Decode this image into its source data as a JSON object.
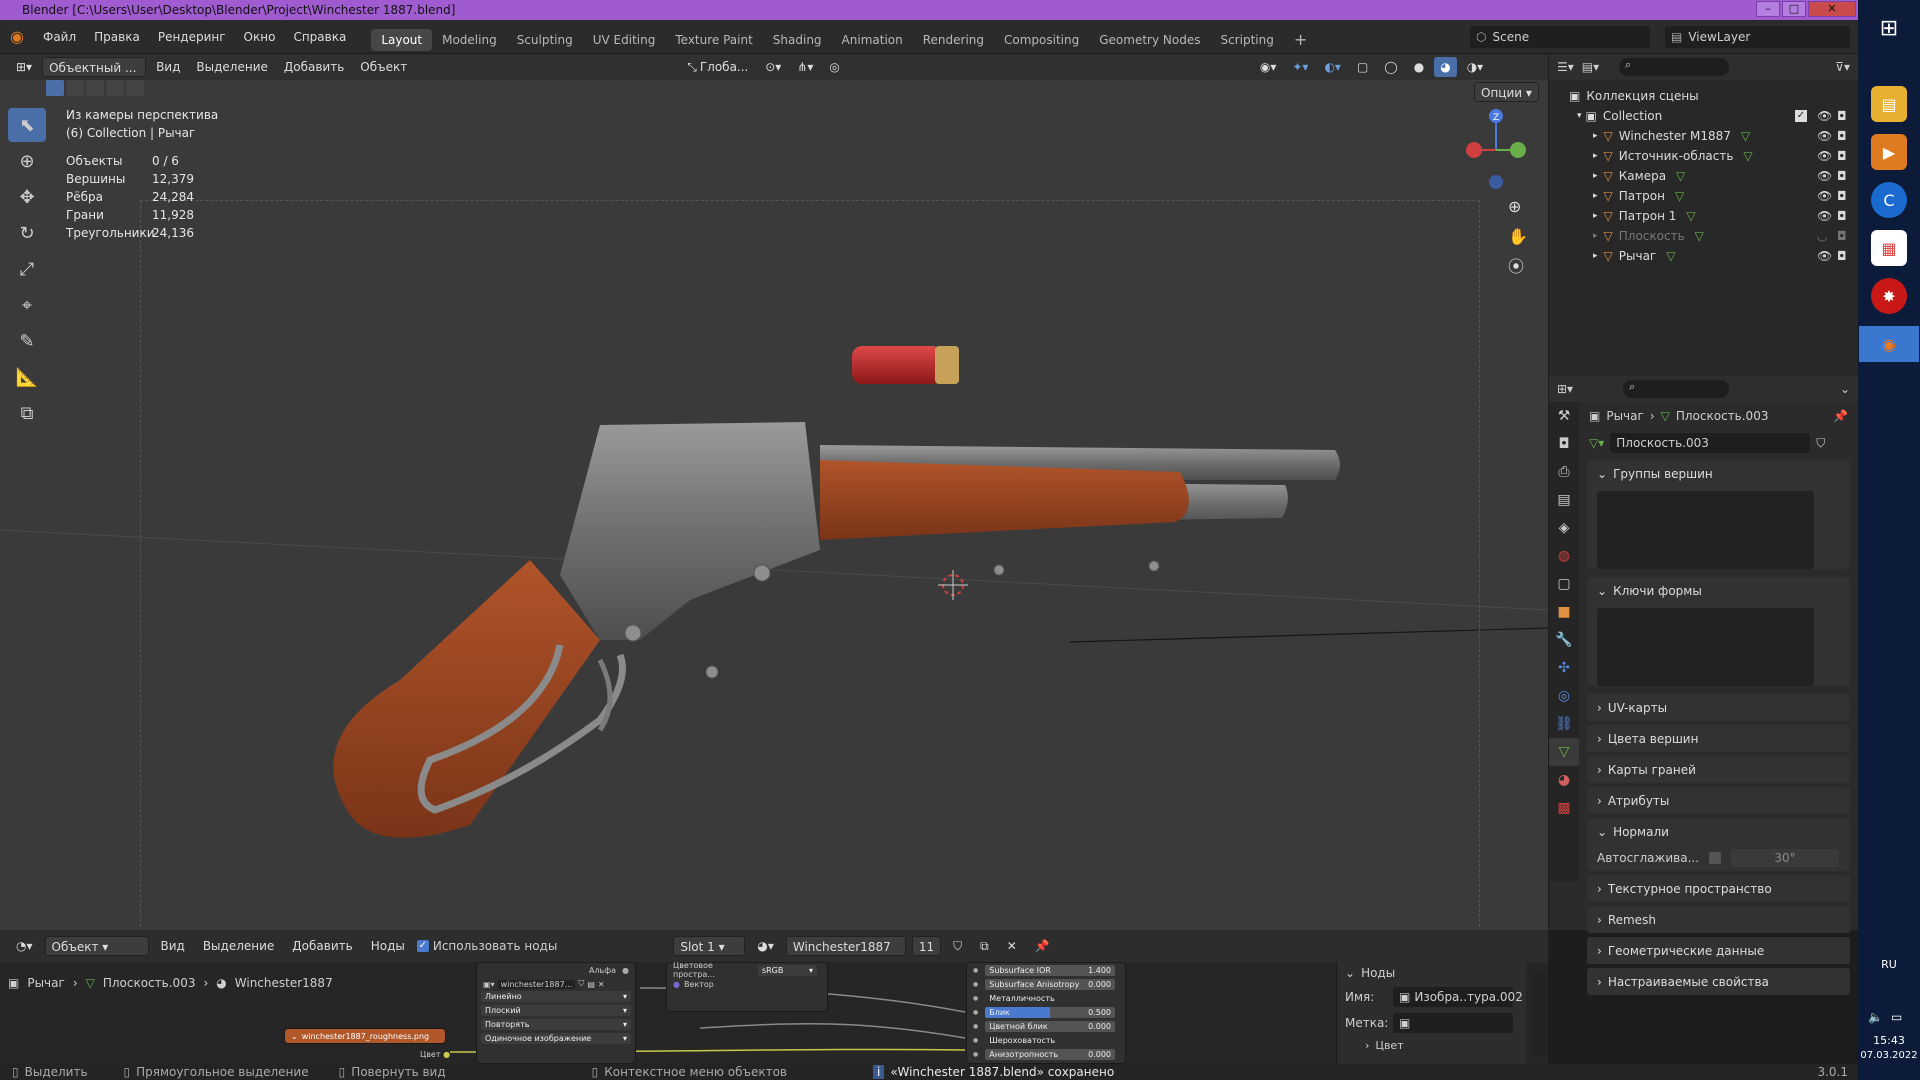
{
  "window": {
    "title": "Blender [C:\\Users\\User\\Desktop\\Blender\\Project\\Winchester 1887.blend]"
  },
  "menu": [
    "Файл",
    "Правка",
    "Рендеринг",
    "Окно",
    "Справка"
  ],
  "workspaces": [
    "Layout",
    "Modeling",
    "Sculpting",
    "UV Editing",
    "Texture Paint",
    "Shading",
    "Animation",
    "Rendering",
    "Compositing",
    "Geometry Nodes",
    "Scripting"
  ],
  "scene": {
    "label": "Scene",
    "viewlayer": "ViewLayer"
  },
  "viewport_header": {
    "mode": "Объектный ...",
    "items": [
      "Вид",
      "Выделение",
      "Добавить",
      "Объект"
    ],
    "orientation": "Глоба...",
    "options": "Опции"
  },
  "overlay_text": {
    "line1": "Из камеры перспектива",
    "line2": "(6) Collection | Рычаг"
  },
  "stats": [
    {
      "k": "Объекты",
      "v": "0 / 6"
    },
    {
      "k": "Вершины",
      "v": "12,379"
    },
    {
      "k": "Рёбра",
      "v": "24,284"
    },
    {
      "k": "Грани",
      "v": "11,928"
    },
    {
      "k": "Треугольники",
      "v": "24,136"
    }
  ],
  "outliner": {
    "root": "Коллекция сцены",
    "collection": "Collection",
    "items": [
      {
        "name": "Winchester M1887",
        "icon": "mesh-icon"
      },
      {
        "name": "Источник-область",
        "icon": "light-icon"
      },
      {
        "name": "Камера",
        "icon": "camera-icon"
      },
      {
        "name": "Патрон",
        "icon": "mesh-icon"
      },
      {
        "name": "Патрон 1",
        "icon": "mesh-icon"
      },
      {
        "name": "Плоскость",
        "icon": "mesh-icon",
        "dim": true
      },
      {
        "name": "Рычаг",
        "icon": "mesh-icon"
      }
    ]
  },
  "properties": {
    "breadcrumb_object": "Рычаг",
    "breadcrumb_data": "Плоскость.003",
    "datablock": "Плоскость.003",
    "panels": [
      "Группы вершин",
      "Ключи формы",
      "UV-карты",
      "Цвета вершин",
      "Карты граней",
      "Атрибуты",
      "Нормали",
      "Текстурное пространство",
      "Remesh",
      "Геометрические данные",
      "Настраиваемые свойства"
    ],
    "autosmooth_label": "Автосглажива...",
    "autosmooth_value": "30°"
  },
  "node_editor": {
    "mode": "Объект",
    "items": [
      "Вид",
      "Выделение",
      "Добавить",
      "Ноды"
    ],
    "use_nodes": "Использовать ноды",
    "slot": "Slot 1",
    "material": "Winchester1887",
    "users": "11",
    "breadcrumb": [
      "Рычаг",
      "Плоскость.003",
      "Winchester1887"
    ],
    "side_panel": {
      "title": "Ноды",
      "name_label": "Имя:",
      "name_value": "Изобра..тура.002",
      "label_label": "Метка:",
      "color_label": "Цвет"
    },
    "image_node": {
      "name": "winchester1887...",
      "options": [
        "Линейно",
        "Плоский",
        "Повторять",
        "Одиночное изображение"
      ],
      "alpha": "Альфа",
      "color": "Цвет",
      "color_space": "Цветовое простра...",
      "srgb": "sRGB",
      "vector": "Вектор"
    },
    "roughness_node": "winchester1887_roughness.png",
    "bsdf_fields": [
      {
        "k": "Subsurface IOR",
        "v": "1.400"
      },
      {
        "k": "Subsurface Anisotropy",
        "v": "0.000"
      },
      {
        "k": "Металличность",
        "v": ""
      },
      {
        "k": "Блик",
        "v": "0.500",
        "hl": true
      },
      {
        "k": "Цветной блик",
        "v": "0.000"
      },
      {
        "k": "Шероховатость",
        "v": ""
      },
      {
        "k": "Анизотропность",
        "v": "0.000"
      }
    ]
  },
  "statusbar": {
    "select": "Выделить",
    "box": "Прямоугольное выделение",
    "rotate": "Повернуть вид",
    "context": "Контекстное меню объектов",
    "saved": "«Winchester 1887.blend» сохранено",
    "version": "3.0.1"
  },
  "taskbar": {
    "lang": "RU",
    "time": "15:43",
    "date": "07.03.2022"
  }
}
